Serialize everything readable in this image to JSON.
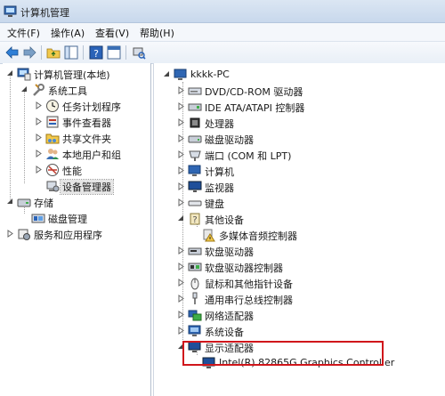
{
  "window": {
    "title": "计算机管理"
  },
  "menu": [
    "文件(F)",
    "操作(A)",
    "查看(V)",
    "帮助(H)"
  ],
  "left_tree": [
    {
      "label": "计算机管理(本地)",
      "icon": "computer-management-icon",
      "expander": "expanded"
    },
    {
      "label": "系统工具",
      "icon": "tools-icon",
      "expander": "expanded"
    },
    {
      "label": "任务计划程序",
      "icon": "clock-icon",
      "expander": "collapsed"
    },
    {
      "label": "事件查看器",
      "icon": "event-viewer-icon",
      "expander": "collapsed"
    },
    {
      "label": "共享文件夹",
      "icon": "shared-folder-icon",
      "expander": "collapsed"
    },
    {
      "label": "本地用户和组",
      "icon": "users-icon",
      "expander": "collapsed"
    },
    {
      "label": "性能",
      "icon": "performance-icon",
      "expander": "collapsed"
    },
    {
      "label": "设备管理器",
      "icon": "device-manager-icon",
      "expander": "none",
      "selected": true
    },
    {
      "label": "存储",
      "icon": "storage-icon",
      "expander": "expanded"
    },
    {
      "label": "磁盘管理",
      "icon": "disk-management-icon",
      "expander": "none"
    },
    {
      "label": "服务和应用程序",
      "icon": "services-icon",
      "expander": "collapsed"
    }
  ],
  "right_tree": [
    {
      "label": "kkkk-PC",
      "icon": "computer-icon",
      "expander": "expanded"
    },
    {
      "label": "DVD/CD-ROM 驱动器",
      "icon": "dvd-drive-icon",
      "expander": "collapsed"
    },
    {
      "label": "IDE ATA/ATAPI 控制器",
      "icon": "ide-controller-icon",
      "expander": "collapsed"
    },
    {
      "label": "处理器",
      "icon": "processor-icon",
      "expander": "collapsed"
    },
    {
      "label": "磁盘驱动器",
      "icon": "disk-drive-icon",
      "expander": "collapsed"
    },
    {
      "label": "端口 (COM 和 LPT)",
      "icon": "port-icon",
      "expander": "collapsed"
    },
    {
      "label": "计算机",
      "icon": "computer-icon",
      "expander": "collapsed"
    },
    {
      "label": "监视器",
      "icon": "monitor-icon",
      "expander": "collapsed"
    },
    {
      "label": "键盘",
      "icon": "keyboard-icon",
      "expander": "collapsed"
    },
    {
      "label": "其他设备",
      "icon": "other-devices-icon",
      "expander": "expanded"
    },
    {
      "label": "多媒体音频控制器",
      "icon": "warning-device-icon",
      "expander": "none"
    },
    {
      "label": "软盘驱动器",
      "icon": "floppy-drive-icon",
      "expander": "collapsed"
    },
    {
      "label": "软盘驱动器控制器",
      "icon": "floppy-controller-icon",
      "expander": "collapsed"
    },
    {
      "label": "鼠标和其他指针设备",
      "icon": "mouse-icon",
      "expander": "collapsed"
    },
    {
      "label": "通用串行总线控制器",
      "icon": "usb-icon",
      "expander": "collapsed"
    },
    {
      "label": "网络适配器",
      "icon": "network-adapter-icon",
      "expander": "collapsed"
    },
    {
      "label": "系统设备",
      "icon": "system-devices-icon",
      "expander": "collapsed"
    },
    {
      "label": "显示适配器",
      "icon": "display-adapter-icon",
      "expander": "expanded"
    },
    {
      "label": "Intel(R) 82865G Graphics Controller",
      "icon": "display-adapter-icon",
      "expander": "none"
    }
  ],
  "colors": {
    "highlight_border": "#d0161b",
    "selection_bg": "#e5e5e5"
  }
}
